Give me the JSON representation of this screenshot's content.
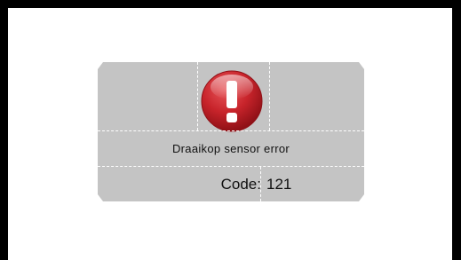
{
  "error_dialog": {
    "icon": "exclamation-error-icon",
    "message": "Draaikop sensor error",
    "code_label": "Code:",
    "code_value": "121"
  },
  "colors": {
    "frame": "#000000",
    "dialog_background": "#c4c4c4",
    "icon_red": "#c8242b",
    "divider": "#ffffff"
  }
}
